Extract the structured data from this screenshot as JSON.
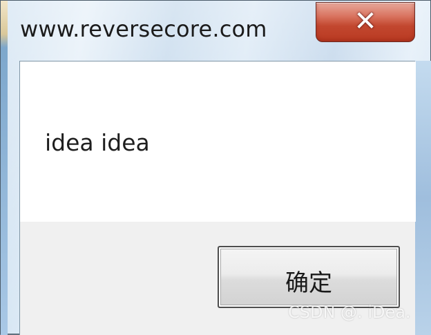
{
  "window": {
    "title": "www.reversecore.com",
    "close_glyph": "✕"
  },
  "dialog": {
    "message": "idea idea",
    "ok_label": "确定"
  },
  "watermark": "CSDN @. iDea.",
  "colors": {
    "close_button": "#c2472f",
    "client_background": "#f0f0f0",
    "message_background": "#ffffff"
  },
  "icons": {
    "close": "close-icon"
  }
}
